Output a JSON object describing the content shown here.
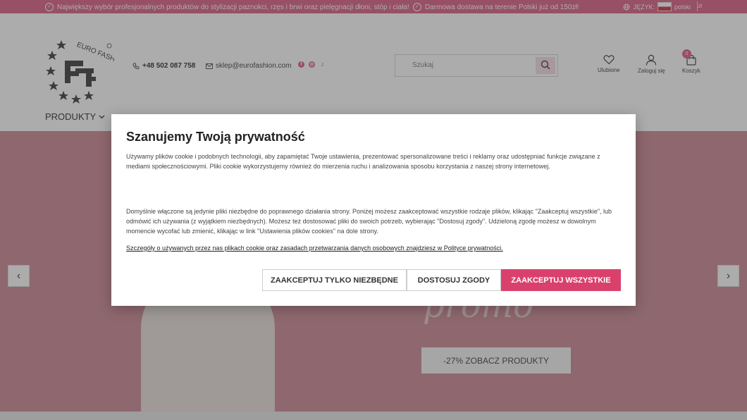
{
  "topbar": {
    "promo1": "Największy wybór profesjonalnych produktów do stylizacji paznokci, rzęs i brwi oraz pielęgnacji dłoni, stóp i ciała!",
    "promo2": "Darmowa dostawa na terenie Polski już od 150zł!",
    "lang_label": "JĘZYK:",
    "lang_value": "polski",
    "currency": "zł"
  },
  "header": {
    "logo_text": "EURO FASHION",
    "logo_mark": "EF",
    "phone": "+48 502 087 758",
    "email": "sklep@eurofashion.com",
    "search_placeholder": "Szukaj",
    "favorites": "Ulubione",
    "login": "Zaloguj się",
    "cart": "Koszyk",
    "cart_count": "0",
    "nav_products": "PRODUKTY"
  },
  "hero": {
    "script_text": "promo",
    "cta": "-27% ZOBACZ PRODUKTY"
  },
  "cookie": {
    "title": "Szanujemy Twoją prywatność",
    "p1": "Używamy plików cookie i podobnych technologii, aby zapamiętać Twoje ustawienia, prezentować spersonalizowane treści i reklamy oraz udostępniać funkcje związane z mediami społecznościowymi. Pliki cookie wykorzystujemy również do mierzenia ruchu i analizowania sposobu korzystania z naszej strony internetowej.",
    "p2": "Domyślnie włączone są jedynie pliki niezbędne do poprawnego działania strony. Poniżej możesz zaakceptować wszystkie rodzaje plików, klikając \"Zaakceptuj wszystkie\", lub odmówić ich używania (z wyjątkiem niezbędnych). Możesz też dostosować pliki do swoich potrzeb, wybierając \"Dostosuj zgody\". Udzieloną zgodę możesz w dowolnym momencie wycofać lub zmienić, klikając w link \"Ustawienia plików cookies\" na dole strony.",
    "link": "Szczegóły o używanych przez nas plikach cookie oraz zasadach przetwarzania danych osobowych znajdziesz w Polityce prywatności.",
    "btn_necessary": "ZAAKCEPTUJ TYLKO NIEZBĘDNE",
    "btn_customize": "DOSTOSUJ ZGODY",
    "btn_accept_all": "ZAAKCEPTUJ WSZYSTKIE"
  },
  "colors": {
    "brand": "#d9587f",
    "accent_button": "#d9416c",
    "hero_bg": "#c9848f"
  }
}
